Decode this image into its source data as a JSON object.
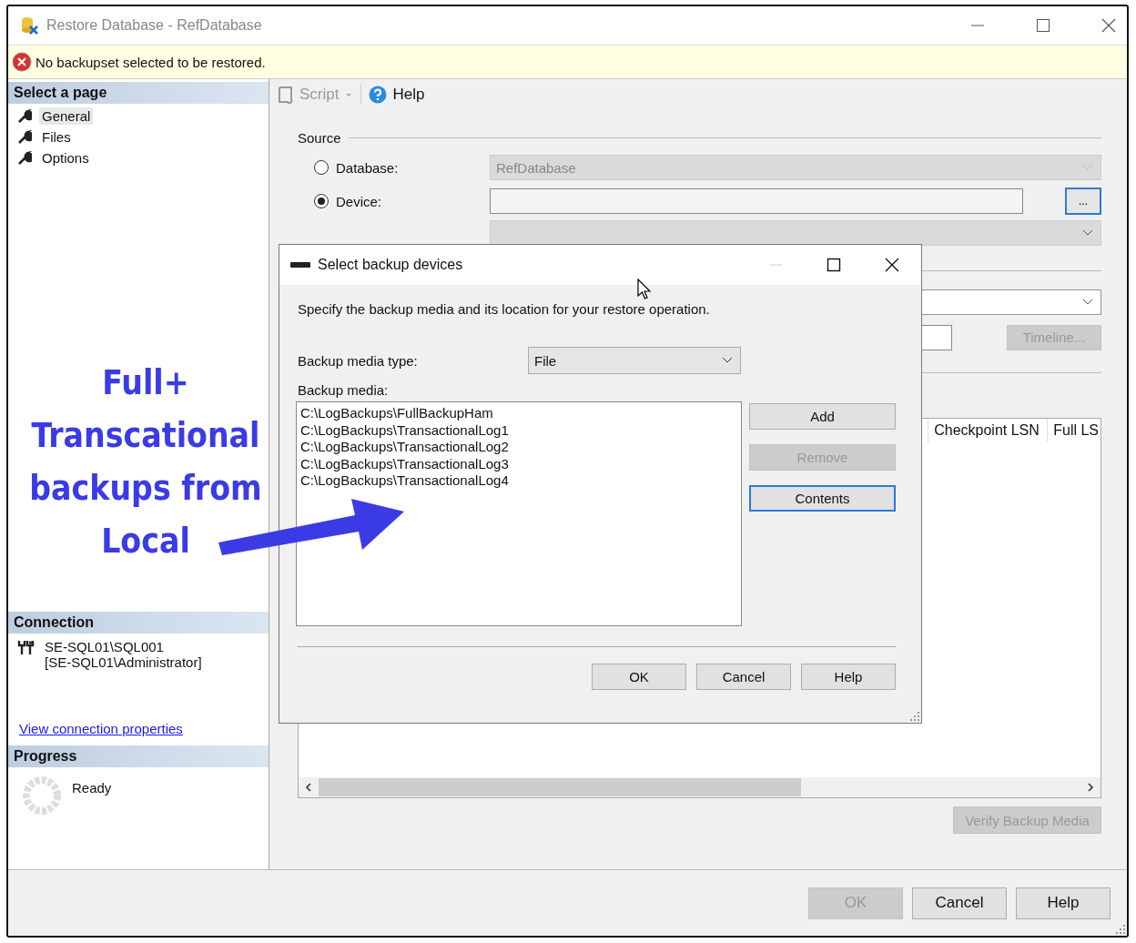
{
  "window": {
    "title": "Restore Database - RefDatabase"
  },
  "error_bar": {
    "message": "No backupset selected to be restored."
  },
  "sidebar": {
    "heading": "Select a page",
    "items": [
      {
        "label": "General",
        "selected": true
      },
      {
        "label": "Files",
        "selected": false
      },
      {
        "label": "Options",
        "selected": false
      }
    ]
  },
  "connection": {
    "heading": "Connection",
    "server": "SE-SQL01\\SQL001",
    "user": "[SE-SQL01\\Administrator]",
    "link": "View connection properties"
  },
  "progress": {
    "heading": "Progress",
    "status": "Ready"
  },
  "toolbar": {
    "items": [
      {
        "label": "Script",
        "disabled": true,
        "kind": "script"
      },
      {
        "label": "Help",
        "disabled": false,
        "kind": "help"
      }
    ]
  },
  "source": {
    "heading": "Source",
    "options": [
      {
        "label": "Database:",
        "selected": false
      },
      {
        "label": "Device:",
        "selected": true
      }
    ],
    "database_value": "RefDatabase",
    "browse_button": "..."
  },
  "timeline_button": {
    "label": "Timeline...",
    "disabled": true
  },
  "grid": {
    "columns": [
      "Checkpoint LSN",
      "Full LS"
    ]
  },
  "verify_button": {
    "label": "Verify Backup Media",
    "disabled": true
  },
  "buttons": [
    {
      "label": "OK",
      "disabled": true
    },
    {
      "label": "Cancel",
      "disabled": false
    },
    {
      "label": "Help",
      "disabled": false
    }
  ],
  "dialog": {
    "title": "Select backup devices",
    "instruction": "Specify the backup media and its location for your restore operation.",
    "media_type_label": "Backup media type:",
    "media_type": "File",
    "media_label": "Backup media:",
    "media": [
      "C:\\LogBackups\\FullBackupHam",
      "C:\\LogBackups\\TransactionalLog1",
      "C:\\LogBackups\\TransactionalLog2",
      "C:\\LogBackups\\TransactionalLog3",
      "C:\\LogBackups\\TransactionalLog4"
    ],
    "side_buttons": [
      {
        "label": "Add",
        "disabled": false,
        "focused": false
      },
      {
        "label": "Remove",
        "disabled": true,
        "focused": false
      },
      {
        "label": "Contents",
        "disabled": false,
        "focused": true
      }
    ],
    "buttons": [
      {
        "label": "OK",
        "disabled": false
      },
      {
        "label": "Cancel",
        "disabled": false
      },
      {
        "label": "Help",
        "disabled": false
      }
    ]
  },
  "annotation": {
    "lines": [
      "Full+",
      "Transcational",
      "backups from",
      "Local"
    ]
  }
}
